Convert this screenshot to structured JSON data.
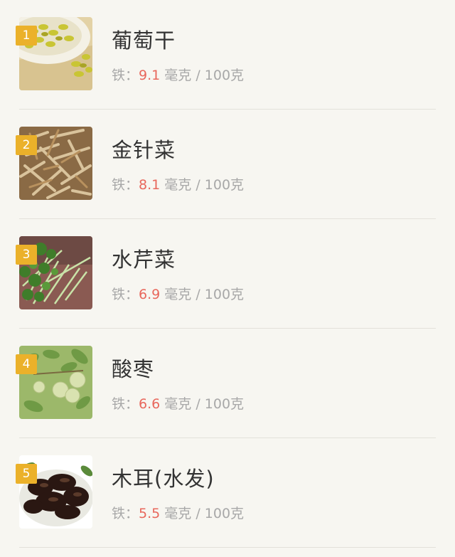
{
  "foods": [
    {
      "rank": "1",
      "name": "葡萄干",
      "label": "铁：",
      "value": "9.1",
      "unit": "毫克",
      "slash": "/",
      "per": "100克"
    },
    {
      "rank": "2",
      "name": "金针菜",
      "label": "铁：",
      "value": "8.1",
      "unit": "毫克",
      "slash": "/",
      "per": "100克"
    },
    {
      "rank": "3",
      "name": "水芹菜",
      "label": "铁：",
      "value": "6.9",
      "unit": "毫克",
      "slash": "/",
      "per": "100克"
    },
    {
      "rank": "4",
      "name": "酸枣",
      "label": "铁：",
      "value": "6.6",
      "unit": "毫克",
      "slash": "/",
      "per": "100克"
    },
    {
      "rank": "5",
      "name": "木耳(水发)",
      "label": "铁：",
      "value": "5.5",
      "unit": "毫克",
      "slash": "/",
      "per": "100克"
    }
  ],
  "colors": {
    "background": "#f7f6f1",
    "rank_badge": "#ebb12a",
    "value_highlight": "#e8675c",
    "name_text": "#333333",
    "meta_text": "#a8a8a8"
  }
}
